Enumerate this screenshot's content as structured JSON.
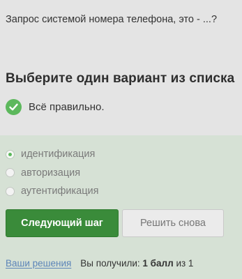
{
  "question": {
    "text": "Запрос системой номера телефона, это - ...?"
  },
  "quiz": {
    "heading": "Выберите один вариант из списка",
    "feedback": {
      "text": "Всё правильно.",
      "icon": "check-circle-icon",
      "color": "#5cb85c"
    },
    "options": [
      {
        "label": "идентификация",
        "selected": true
      },
      {
        "label": "авторизация",
        "selected": false
      },
      {
        "label": "аутентификация",
        "selected": false
      }
    ]
  },
  "actions": {
    "next_label": "Следующий шаг",
    "retry_label": "Решить снова"
  },
  "footer": {
    "solutions_link": "Ваши решения",
    "score_prefix": "Вы получили:",
    "score_value": "1 балл",
    "score_suffix": "из 1"
  },
  "colors": {
    "page_background": "#e4e4e4",
    "answer_area": "#d6e1d5",
    "primary_button": "#3a8b3a",
    "link": "#5b84b8"
  }
}
